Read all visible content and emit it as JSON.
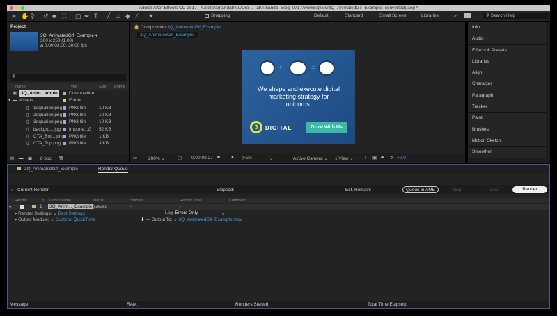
{
  "window": {
    "title": "Adobe After Effects CC 2017 - /Users/amandatrieu/Dro ... tal/Amanda_Blog_0717/workingfiles/3Q_AnimatedGif_Example (converted).aep *"
  },
  "toolbar": {
    "snapping": "Snapping",
    "workspaces": [
      "Default",
      "Standard",
      "Small Screen",
      "Libraries"
    ],
    "more": "»",
    "search_placeholder": "Search Help"
  },
  "project": {
    "title": "Project",
    "comp_name": "3Q_AnimatedGif_Example ▾",
    "comp_size": "300 x 250 (1.00)",
    "comp_duration": "Δ 0:00:03:00, 30.00 fps",
    "search_placeholder": "",
    "columns": [
      "Name",
      "Type",
      "Size",
      "Frame"
    ],
    "items": [
      {
        "name": "3Q_Anim...ample",
        "type": "Composition",
        "size": "",
        "indent": 0,
        "kind": "comp",
        "color": "#c9b48a"
      },
      {
        "name": "Assets",
        "type": "Folder",
        "size": "",
        "indent": 0,
        "kind": "folder",
        "color": "#e6d84a"
      },
      {
        "name": "1equation.png",
        "type": "PNG file",
        "size": "10 KB",
        "indent": 1,
        "kind": "file",
        "color": "#a9a6d6"
      },
      {
        "name": "2equation.png",
        "type": "PNG file",
        "size": "10 KB",
        "indent": 1,
        "kind": "file",
        "color": "#a9a6d6"
      },
      {
        "name": "3equation.png",
        "type": "PNG file",
        "size": "10 KB",
        "indent": 1,
        "kind": "file",
        "color": "#a9a6d6"
      },
      {
        "name": "backgro....jpg",
        "type": "Importe...G",
        "size": "52 KB",
        "indent": 1,
        "kind": "file",
        "color": "#a9a6d6"
      },
      {
        "name": "CTA_Bot....png",
        "type": "PNG file",
        "size": "1 KB",
        "indent": 1,
        "kind": "file",
        "color": "#a9a6d6"
      },
      {
        "name": "CTA_Top.png",
        "type": "PNG file",
        "size": "3 KB",
        "indent": 1,
        "kind": "file",
        "color": "#a9a6d6"
      }
    ],
    "bpc": "8 bpc"
  },
  "composition": {
    "label": "Composition",
    "name": "3Q_AnimatedGif_Example",
    "tab": "3Q_AnimatedGif_Example",
    "banner": {
      "headline": "We shape and execute digital marketing strategy for unicorns.",
      "logo": "DIGITAL",
      "logo_mark": "3",
      "cta": "Grow With Us"
    },
    "zoom": "200%",
    "timecode": "0:00:02:27",
    "resolution": "(Full)",
    "camera": "Active Camera",
    "views": "1 View",
    "exposure": "+0.0"
  },
  "right_panel": {
    "items": [
      "Info",
      "Audio",
      "Effects & Presets",
      "Libraries",
      "Align",
      "Character",
      "Paragraph",
      "Tracker",
      "Paint",
      "Brushes",
      "Motion Sketch",
      "Smoother"
    ]
  },
  "render_queue": {
    "tabs": [
      "3Q_AnimatedGif_Example",
      "Render Queue"
    ],
    "current_render": "Current Render",
    "elapsed": "Elapsed:",
    "est_remain": "Est. Remain:",
    "buttons": {
      "queue_ame": "Queue in AME",
      "stop": "Stop",
      "pause": "Pause",
      "render": "Render"
    },
    "columns": [
      "Render",
      "#",
      "Comp Name",
      "Status",
      "Started",
      "Render Time",
      "Comment"
    ],
    "item": {
      "num": "1",
      "comp": "3Q_Anim..._Example",
      "status": "Queued",
      "started": "-",
      "render_time": "-"
    },
    "render_settings_label": "Render Settings:",
    "render_settings": "Best Settings",
    "log_label": "Log:",
    "log": "Errors Only",
    "output_module_label": "Output Module:",
    "output_module": "Custom: QuickTime",
    "output_to_label": "Output To:",
    "output_to": "3Q_AnimatedGif_Example.mov",
    "status": {
      "message": "Message:",
      "ram": "RAM:",
      "renders_started": "Renders Started:",
      "total_time": "Total Time Elapsed:"
    }
  },
  "colors": {
    "accent": "#4a9be0",
    "banner_bg": "#2a5a94",
    "cta": "#3bb9a5",
    "logo": "#e3e53a"
  }
}
